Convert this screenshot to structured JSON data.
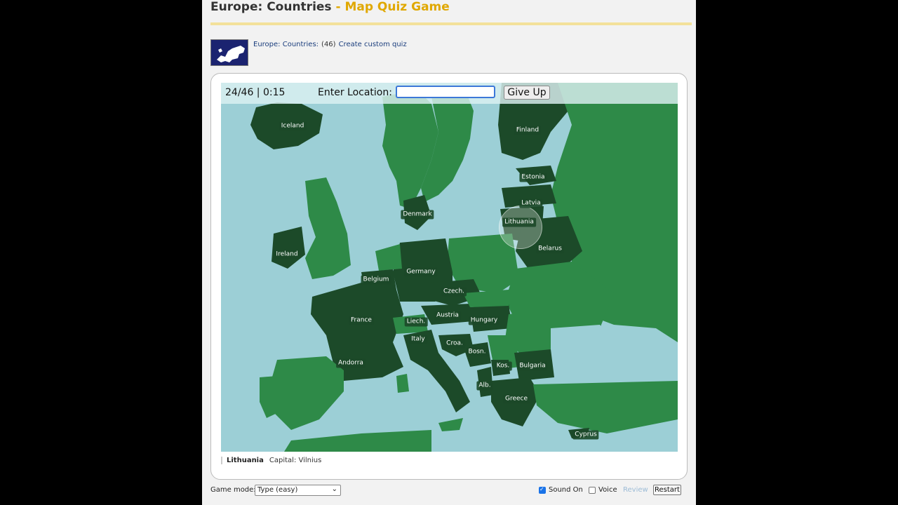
{
  "header": {
    "title": "Europe: Countries",
    "subtitle": "- Map Quiz Game"
  },
  "breadcrumb": {
    "quiz_link": "Europe: Countries:",
    "count": "(46)",
    "custom_link": "Create custom quiz"
  },
  "quiz": {
    "score": "24/46 | 0:15",
    "enter_label": "Enter Location:",
    "input_value": "",
    "give_up": "Give Up"
  },
  "countries": [
    {
      "name": "Iceland"
    },
    {
      "name": "Finland"
    },
    {
      "name": "Estonia"
    },
    {
      "name": "Latvia"
    },
    {
      "name": "Lithuania"
    },
    {
      "name": "Denmark"
    },
    {
      "name": "Belarus"
    },
    {
      "name": "Ireland"
    },
    {
      "name": "Germany"
    },
    {
      "name": "Belgium"
    },
    {
      "name": "Czech."
    },
    {
      "name": "Liech."
    },
    {
      "name": "Austria"
    },
    {
      "name": "Hungary"
    },
    {
      "name": "France"
    },
    {
      "name": "Italy"
    },
    {
      "name": "Croa."
    },
    {
      "name": "Bosn."
    },
    {
      "name": "Andorra"
    },
    {
      "name": "Kos."
    },
    {
      "name": "Bulgaria"
    },
    {
      "name": "Alb."
    },
    {
      "name": "Greece"
    },
    {
      "name": "Cyprus"
    }
  ],
  "status": {
    "country": "Lithuania",
    "capital": "Capital: Vilnius"
  },
  "controls": {
    "game_mode_label": "Game mode:",
    "game_mode_value": "Type (easy)",
    "sound_label": "Sound On",
    "sound_on": true,
    "voice_label": "Voice",
    "voice_on": false,
    "review_label": "Review",
    "restart_label": "Restart"
  },
  "colors": {
    "water": "#9ccfd6",
    "answered": "#1c4a29",
    "unanswered": "#2e8a48",
    "accent": "#e0a800"
  }
}
